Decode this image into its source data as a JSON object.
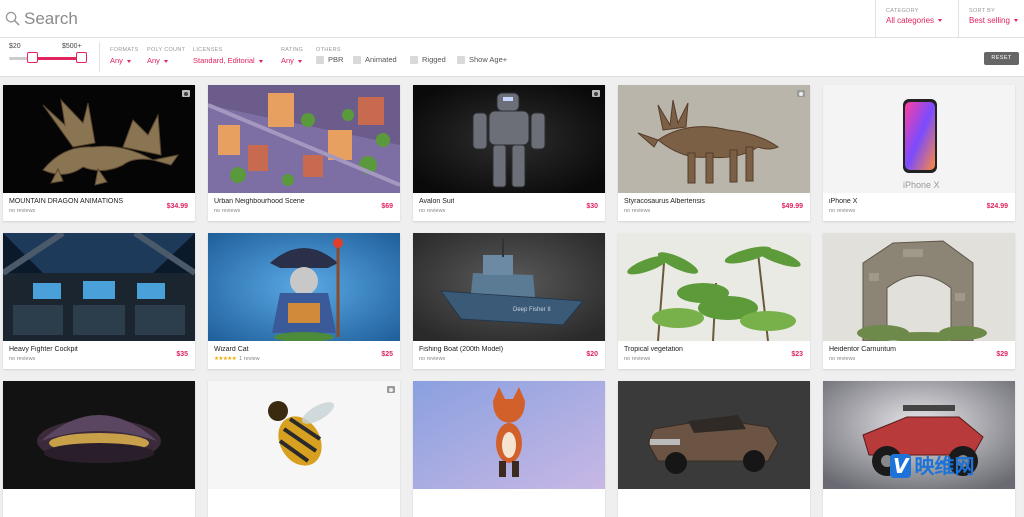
{
  "search": {
    "placeholder": "Search"
  },
  "category": {
    "label": "CATEGORY",
    "value": "All categories"
  },
  "sort": {
    "label": "SORT BY",
    "value": "Best selling"
  },
  "price": {
    "min": "$20",
    "max": "$500+",
    "range_fraction": [
      0.3,
      1.0
    ]
  },
  "filters": [
    {
      "label": "FORMATS",
      "value": "Any"
    },
    {
      "label": "POLY COUNT",
      "value": "Any"
    },
    {
      "label": "LICENSES",
      "value": "Standard, Editorial"
    },
    {
      "label": "RATING",
      "value": "Any"
    }
  ],
  "others": {
    "label": "OTHERS",
    "options": [
      "PBR",
      "Animated",
      "Rigged",
      "Show Age+"
    ]
  },
  "reset_label": "RESET",
  "models": [
    {
      "title": "MOUNTAIN DRAGON ANIMATIONS",
      "price": "$34.99",
      "reviews": "no reviews",
      "icon": "dragon"
    },
    {
      "title": "Urban Neighbourhood Scene",
      "price": "$69",
      "reviews": "no reviews",
      "icon": "city"
    },
    {
      "title": "Avalon Suit",
      "price": "$30",
      "reviews": "no reviews",
      "icon": "robot"
    },
    {
      "title": "Styracosaurus Albertensis",
      "price": "$49.99",
      "reviews": "no reviews",
      "icon": "dinosaur"
    },
    {
      "title": "iPhone X",
      "price": "$24.99",
      "reviews": "no reviews",
      "icon": "phone",
      "thumb_text": "iPhone X"
    },
    {
      "title": "Heavy Fighter Cockpit",
      "price": "$35",
      "reviews": "no reviews",
      "icon": "cockpit"
    },
    {
      "title": "Wizard Cat",
      "price": "$25",
      "reviews": "1 review",
      "rating_stars": 5,
      "stars": "★★★★★",
      "icon": "cat"
    },
    {
      "title": "Fishing Boat (200th Model)",
      "price": "$20",
      "reviews": "no reviews",
      "icon": "boat",
      "thumb_text": "Deep Fisher II"
    },
    {
      "title": "Tropical vegetation",
      "price": "$23",
      "reviews": "no reviews",
      "icon": "palm"
    },
    {
      "title": "Heidentor Carnuntum",
      "price": "$29",
      "reviews": "no reviews",
      "icon": "ruins"
    },
    {
      "title": "",
      "price": "",
      "reviews": "",
      "icon": "mussel"
    },
    {
      "title": "",
      "price": "",
      "reviews": "",
      "icon": "wasp"
    },
    {
      "title": "",
      "price": "",
      "reviews": "",
      "icon": "fox"
    },
    {
      "title": "",
      "price": "",
      "reviews": "",
      "icon": "truck"
    },
    {
      "title": "",
      "price": "",
      "reviews": "",
      "icon": "buggy"
    }
  ],
  "watermark": {
    "badge": "V",
    "text": "映维网"
  },
  "colors": {
    "accent": "#e0245e",
    "background": "#efefef",
    "watermark": "#1e73d8"
  }
}
